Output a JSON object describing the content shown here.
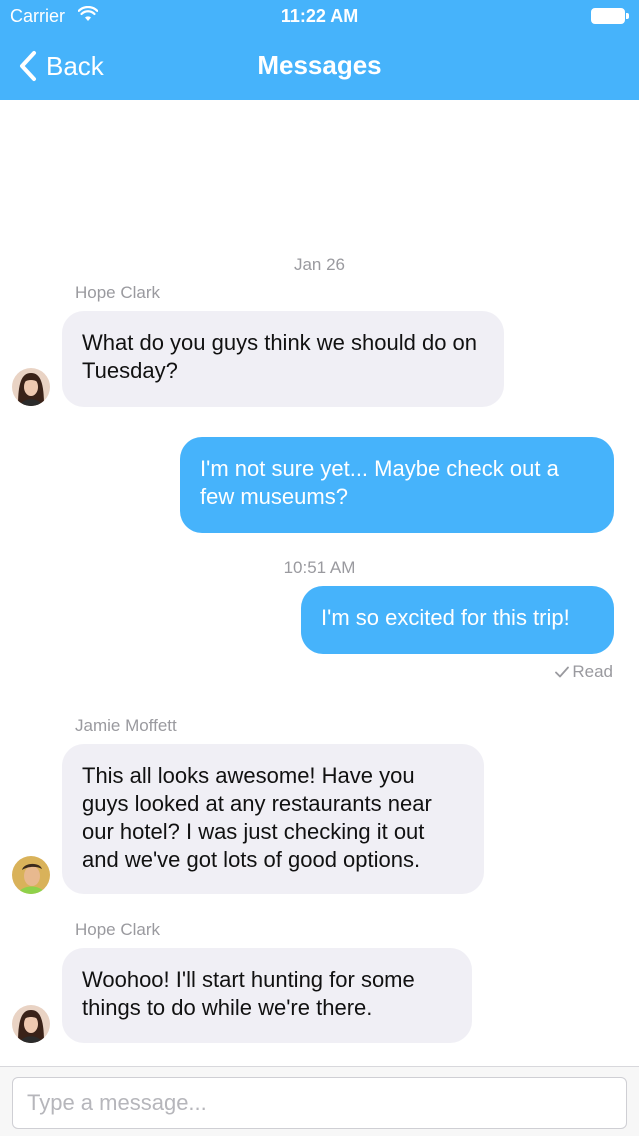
{
  "status_bar": {
    "carrier": "Carrier",
    "time": "11:22 AM"
  },
  "nav": {
    "back_label": "Back",
    "title": "Messages"
  },
  "thread": {
    "date_1": "Jan 26",
    "date_2": "10:51 AM",
    "messages": [
      {
        "sender": "Hope Clark",
        "text": "What do you guys think we should do on Tuesday?"
      },
      {
        "text": "I'm not sure yet... Maybe check out a few museums?"
      },
      {
        "text": "I'm so excited for this trip!"
      },
      {
        "sender": "Jamie Moffett",
        "text": "This all looks awesome! Have you guys looked at any restaurants near our hotel? I was just checking it out and we've got lots of good options."
      },
      {
        "sender": "Hope Clark",
        "text": "Woohoo! I'll start hunting for some things to do while we're there."
      }
    ],
    "read_receipt": "Read"
  },
  "composer": {
    "placeholder": "Type a message..."
  },
  "colors": {
    "accent": "#46b3fb",
    "incoming_bubble": "#f0eff5",
    "meta_text": "#9a9a9f"
  }
}
